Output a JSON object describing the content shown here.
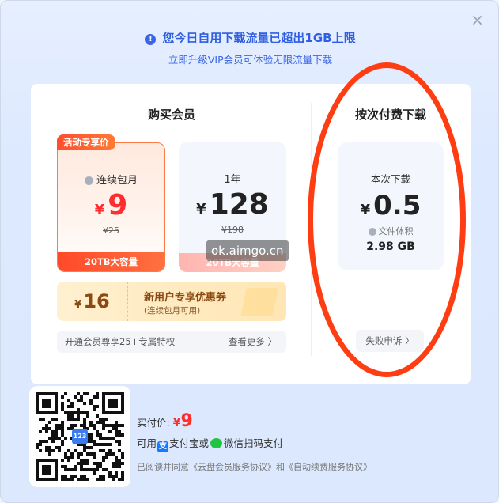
{
  "close_label": "×",
  "header": {
    "title": "您今日自用下载流量已超出1GB上限",
    "subtitle": "立即升级VIP会员可体验无限流量下载"
  },
  "membership": {
    "section_title": "购买会员",
    "badge": "活动专享价",
    "plans": [
      {
        "name": "连续包月",
        "currency": "¥",
        "price": "9",
        "original": "¥25",
        "footer": "20TB大容量"
      },
      {
        "name": "1年",
        "currency": "¥",
        "price": "128",
        "original": "¥198",
        "footer": "20TB大容量"
      }
    ],
    "coupon": {
      "currency": "¥",
      "amount": "16",
      "title": "新用户专享优惠券",
      "note": "(连续包月可用)"
    },
    "perks": {
      "text": "开通会员尊享25+专属特权",
      "more": "查看更多 〉"
    }
  },
  "pay_per_download": {
    "section_title": "按次付费下载",
    "label": "本次下载",
    "currency": "¥",
    "price": "0.5",
    "file_volume_label": "文件体积",
    "file_size": "2.98 GB",
    "appeal": "失败申诉 〉"
  },
  "payment": {
    "price_label": "实付价:",
    "currency": "¥",
    "price": "9",
    "method_prefix": "可用",
    "alipay_icon_text": "支",
    "alipay_text": "支付宝或",
    "wechat_text": "微信扫码支付",
    "agreement": "已阅读并同意《云盘会员服务协议》和《自动续费服务协议》",
    "qr_logo": "123"
  },
  "watermark": "ok.aimgo.cn",
  "colors": {
    "accent": "#2f5fe0",
    "price_red": "#ff2d2d",
    "annotation": "#ff3d12"
  }
}
